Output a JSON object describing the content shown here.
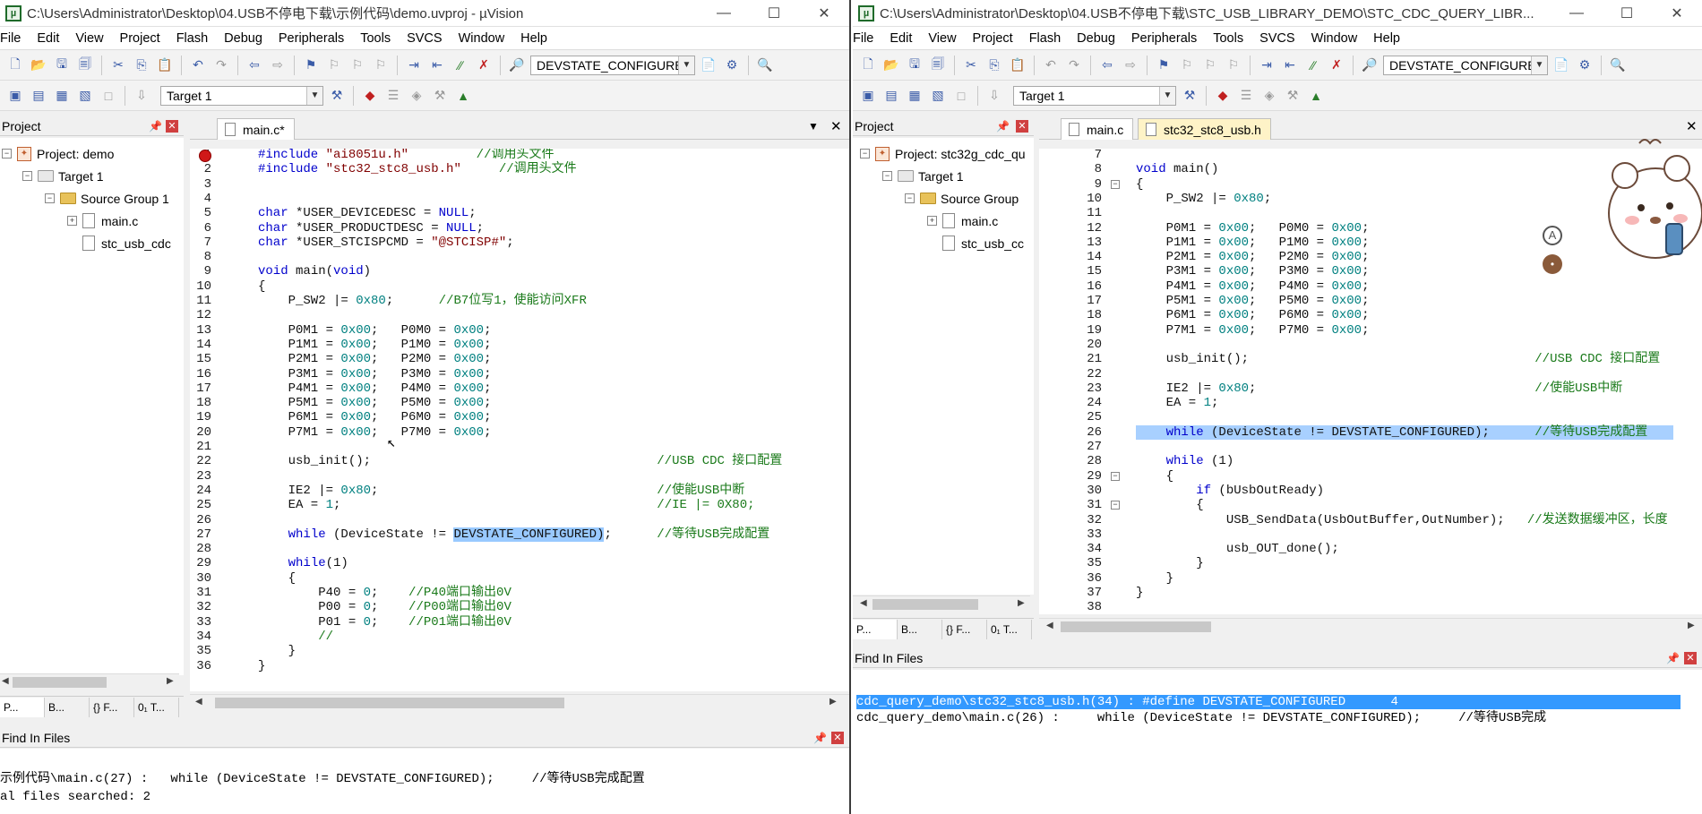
{
  "left": {
    "title": "C:\\Users\\Administrator\\Desktop\\04.USB不停电下载\\示例代码\\demo.uvproj - µVision",
    "menu": [
      "File",
      "Edit",
      "View",
      "Project",
      "Flash",
      "Debug",
      "Peripherals",
      "Tools",
      "SVCS",
      "Window",
      "Help"
    ],
    "toolbar": {
      "target_combo": "DEVSTATE_CONFIGURED",
      "build_target": "Target 1"
    },
    "project_panel": {
      "title": "Project",
      "items": {
        "project": "Project: demo",
        "target": "Target 1",
        "group": "Source Group 1",
        "file1": "main.c",
        "file2": "stc_usb_cdc"
      }
    },
    "bottom_tabs": [
      "P...",
      "B...",
      "{} F...",
      "0₁ T..."
    ],
    "editor": {
      "tab": "main.c*",
      "lines": [
        {
          "n": "1",
          "c": "#include \"ai8051u.h\"         //调用头文件",
          "k": "pp"
        },
        {
          "n": "2",
          "c": "#include \"stc32_stc8_usb.h\"     //调用头文件",
          "k": "pp"
        },
        {
          "n": "3",
          "c": ""
        },
        {
          "n": "4",
          "c": ""
        },
        {
          "n": "5",
          "c": "char *USER_DEVICEDESC = NULL;"
        },
        {
          "n": "6",
          "c": "char *USER_PRODUCTDESC = NULL;"
        },
        {
          "n": "7",
          "c": "char *USER_STCISPCMD = \"@STCISP#\";"
        },
        {
          "n": "8",
          "c": ""
        },
        {
          "n": "9",
          "c": "void main(void)"
        },
        {
          "n": "10",
          "c": "{"
        },
        {
          "n": "11",
          "c": "    P_SW2 |= 0x80;      //B7位写1，使能访问XFR"
        },
        {
          "n": "12",
          "c": ""
        },
        {
          "n": "13",
          "c": "    P0M1 = 0x00;   P0M0 = 0x00;"
        },
        {
          "n": "14",
          "c": "    P1M1 = 0x00;   P1M0 = 0x00;"
        },
        {
          "n": "15",
          "c": "    P2M1 = 0x00;   P2M0 = 0x00;"
        },
        {
          "n": "16",
          "c": "    P3M1 = 0x00;   P3M0 = 0x00;"
        },
        {
          "n": "17",
          "c": "    P4M1 = 0x00;   P4M0 = 0x00;"
        },
        {
          "n": "18",
          "c": "    P5M1 = 0x00;   P5M0 = 0x00;"
        },
        {
          "n": "19",
          "c": "    P6M1 = 0x00;   P6M0 = 0x00;"
        },
        {
          "n": "20",
          "c": "    P7M1 = 0x00;   P7M0 = 0x00;"
        },
        {
          "n": "21",
          "c": ""
        },
        {
          "n": "22",
          "c": "    usb_init();                                      //USB CDC 接口配置"
        },
        {
          "n": "23",
          "c": ""
        },
        {
          "n": "24",
          "c": "    IE2 |= 0x80;                                     //使能USB中断"
        },
        {
          "n": "25",
          "c": "    EA = 1;                                          //IE |= 0X80;"
        },
        {
          "n": "26",
          "c": ""
        },
        {
          "n": "27",
          "c": "    while (DeviceState != DEVSTATE_CONFIGURED);      //等待USB完成配置"
        },
        {
          "n": "28",
          "c": ""
        },
        {
          "n": "29",
          "c": "    while(1)"
        },
        {
          "n": "30",
          "c": "    {"
        },
        {
          "n": "31",
          "c": "        P40 = 0;    //P40端口输出0V"
        },
        {
          "n": "32",
          "c": "        P00 = 0;    //P00端口输出0V"
        },
        {
          "n": "33",
          "c": "        P01 = 0;    //P01端口输出0V"
        },
        {
          "n": "34",
          "c": "        //"
        },
        {
          "n": "35",
          "c": "    }"
        },
        {
          "n": "36",
          "c": "}"
        }
      ]
    },
    "find_panel": {
      "title": "Find In Files",
      "line1": "示例代码\\main.c(27) :   while (DeviceState != DEVSTATE_CONFIGURED);     //等待USB完成配置",
      "line2": "al files searched: 2"
    }
  },
  "right": {
    "title": "C:\\Users\\Administrator\\Desktop\\04.USB不停电下载\\STC_USB_LIBRARY_DEMO\\STC_CDC_QUERY_LIBR...",
    "menu": [
      "File",
      "Edit",
      "View",
      "Project",
      "Flash",
      "Debug",
      "Peripherals",
      "Tools",
      "SVCS",
      "Window",
      "Help"
    ],
    "toolbar": {
      "target_combo": "DEVSTATE_CONFIGURED",
      "build_target": "Target 1"
    },
    "project_panel": {
      "title": "Project",
      "items": {
        "project": "Project: stc32g_cdc_qu",
        "target": "Target 1",
        "group": "Source Group",
        "file1": "main.c",
        "file2": "stc_usb_cc"
      }
    },
    "bottom_tabs": [
      "P...",
      "B...",
      "{} F...",
      "0₁ T..."
    ],
    "editor": {
      "tab1": "main.c",
      "tab2": "stc32_stc8_usb.h",
      "lines": [
        {
          "n": "7",
          "c": ""
        },
        {
          "n": "8",
          "c": "void main()"
        },
        {
          "n": "9",
          "c": "{"
        },
        {
          "n": "10",
          "c": "    P_SW2 |= 0x80;"
        },
        {
          "n": "11",
          "c": ""
        },
        {
          "n": "12",
          "c": "    P0M1 = 0x00;   P0M0 = 0x00;"
        },
        {
          "n": "13",
          "c": "    P1M1 = 0x00;   P1M0 = 0x00;"
        },
        {
          "n": "14",
          "c": "    P2M1 = 0x00;   P2M0 = 0x00;"
        },
        {
          "n": "15",
          "c": "    P3M1 = 0x00;   P3M0 = 0x00;"
        },
        {
          "n": "16",
          "c": "    P4M1 = 0x00;   P4M0 = 0x00;"
        },
        {
          "n": "17",
          "c": "    P5M1 = 0x00;   P5M0 = 0x00;"
        },
        {
          "n": "18",
          "c": "    P6M1 = 0x00;   P6M0 = 0x00;"
        },
        {
          "n": "19",
          "c": "    P7M1 = 0x00;   P7M0 = 0x00;"
        },
        {
          "n": "20",
          "c": ""
        },
        {
          "n": "21",
          "c": "    usb_init();                                      //USB CDC 接口配置"
        },
        {
          "n": "22",
          "c": ""
        },
        {
          "n": "23",
          "c": "    IE2 |= 0x80;                                     //使能USB中断"
        },
        {
          "n": "24",
          "c": "    EA = 1;"
        },
        {
          "n": "25",
          "c": ""
        },
        {
          "n": "26",
          "c": "    while (DeviceState != DEVSTATE_CONFIGURED);      //等待USB完成配置"
        },
        {
          "n": "27",
          "c": ""
        },
        {
          "n": "28",
          "c": "    while (1)"
        },
        {
          "n": "29",
          "c": "    {"
        },
        {
          "n": "30",
          "c": "        if (bUsbOutReady)"
        },
        {
          "n": "31",
          "c": "        {"
        },
        {
          "n": "32",
          "c": "            USB_SendData(UsbOutBuffer,OutNumber);   //发送数据缓冲区，长度"
        },
        {
          "n": "33",
          "c": ""
        },
        {
          "n": "34",
          "c": "            usb_OUT_done();"
        },
        {
          "n": "35",
          "c": "        }"
        },
        {
          "n": "36",
          "c": "    }"
        },
        {
          "n": "37",
          "c": "}"
        },
        {
          "n": "38",
          "c": ""
        }
      ]
    },
    "find_panel": {
      "title": "Find In Files",
      "line1": "cdc_query_demo\\stc32_stc8_usb.h(34) : #define DEVSTATE_CONFIGURED      4",
      "line2": "cdc_query_demo\\main.c(26) :     while (DeviceState != DEVSTATE_CONFIGURED);     //等待USB完成"
    }
  }
}
